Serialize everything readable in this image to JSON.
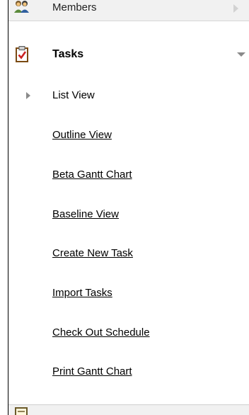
{
  "sections": {
    "members": {
      "label": "Members",
      "icon": "members-icon",
      "expanded": false
    },
    "tasks": {
      "label": "Tasks",
      "icon": "clipboard-check-icon",
      "expanded": true
    },
    "next": {
      "label": "",
      "icon": "document-icon"
    }
  },
  "tasks_menu": {
    "current_item": "List View",
    "items": [
      {
        "label": "List View",
        "current": true
      },
      {
        "label": "Outline View",
        "current": false
      },
      {
        "label": "Beta Gantt Chart",
        "current": false
      },
      {
        "label": "Baseline View",
        "current": false
      },
      {
        "label": "Create New Task",
        "current": false
      },
      {
        "label": "Import Tasks",
        "current": false
      },
      {
        "label": "Check Out Schedule",
        "current": false
      },
      {
        "label": "Print Gantt Chart",
        "current": false
      }
    ]
  },
  "colors": {
    "header_bg": "#f1f1f1",
    "text": "#000000",
    "check_red": "#cc2222",
    "arrow_gray": "#8a8a8a"
  }
}
